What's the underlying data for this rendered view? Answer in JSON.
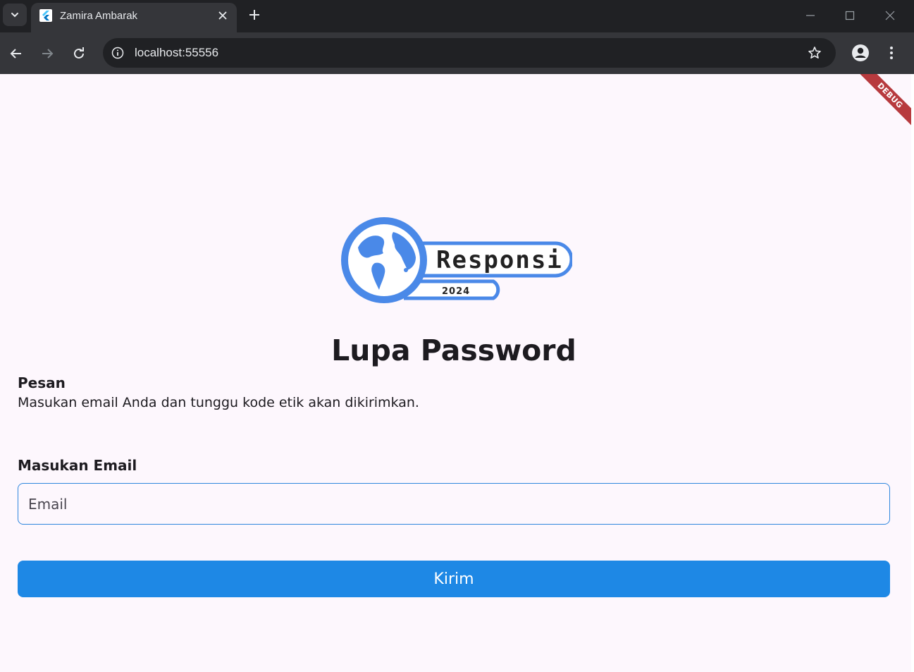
{
  "browser": {
    "tab_title": "Zamira Ambarak",
    "url": "localhost:55556",
    "icons": {
      "tab_menu": "chevron-down-icon",
      "close": "close-icon",
      "new_tab": "plus-icon",
      "back": "arrow-left-icon",
      "forward": "arrow-right-icon",
      "reload": "reload-icon",
      "info": "info-icon",
      "bookmark": "star-icon",
      "profile": "profile-icon",
      "menu": "kebab-menu-icon"
    }
  },
  "app": {
    "debug_banner": "DEBUG",
    "logo": {
      "word": "Responsi",
      "year": "2024",
      "color": "#4a89e8"
    },
    "title": "Lupa Password",
    "message_label": "Pesan",
    "message_text": "Masukan email Anda dan tunggu kode etik akan dikirimkan.",
    "email_label": "Masukan Email",
    "email_placeholder": "Email",
    "email_value": "",
    "submit_label": "Kirim",
    "colors": {
      "background": "#fdf7fd",
      "primary": "#1e88e5",
      "input_border": "#2e86de",
      "debug": "#b73a3e"
    }
  }
}
